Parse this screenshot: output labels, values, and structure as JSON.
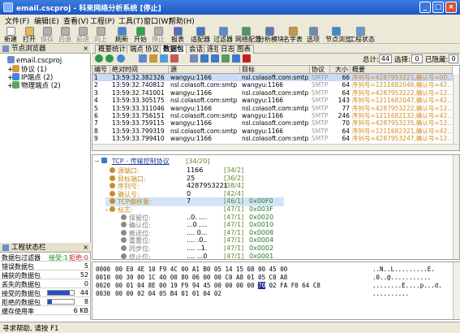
{
  "window": {
    "title": "email.cscproj - 科来网络分析系统 [停止]",
    "minimize": "_",
    "maximize": "□",
    "close": "×"
  },
  "menu": [
    "文件(F)",
    "编辑(E)",
    "查看(V)",
    "工程(P)",
    "工具(T)",
    "窗口(W)",
    "帮助(H)"
  ],
  "toolbar": [
    {
      "label": "新建",
      "icon": "new-icon",
      "color": "#f4f4f4",
      "enabled": true
    },
    {
      "label": "打开",
      "icon": "open-icon",
      "color": "#e8b84a",
      "enabled": true
    },
    {
      "label": "保存",
      "icon": "save-icon",
      "color": "#b0b0b0",
      "enabled": false
    },
    {
      "label": "后退",
      "icon": "back-icon",
      "color": "#b0b0b0",
      "enabled": false
    },
    {
      "label": "前进",
      "icon": "forward-icon",
      "color": "#b0b0b0",
      "enabled": false
    },
    {
      "label": "向上",
      "icon": "up-icon",
      "color": "#b0b0b0",
      "enabled": false
    },
    {
      "label": "刷新",
      "icon": "refresh-icon",
      "color": "#3a8ad8",
      "enabled": true
    },
    {
      "label": "开始",
      "icon": "start-icon",
      "color": "#2aa84a",
      "enabled": true
    },
    {
      "label": "停止",
      "icon": "stop-icon",
      "color": "#b0b0b0",
      "enabled": false
    },
    {
      "label": "报表",
      "icon": "report-icon",
      "color": "#4a70c0",
      "enabled": true
    },
    {
      "label": "适配器",
      "icon": "adapter-icon",
      "color": "#3a78c8",
      "enabled": true
    },
    {
      "label": "过滤器",
      "icon": "filter-icon",
      "color": "#5a8ad0",
      "enabled": true
    },
    {
      "label": "网络配置",
      "icon": "network-config-icon",
      "color": "#4a9a5a",
      "enabled": true
    },
    {
      "label": "分析模块",
      "icon": "analysis-module-icon",
      "color": "#5a7ab8",
      "enabled": true
    },
    {
      "label": "名字表",
      "icon": "name-table-icon",
      "color": "#c89a3a",
      "enabled": true
    },
    {
      "label": "选项",
      "icon": "options-icon",
      "color": "#6a8ab8",
      "enabled": true
    },
    {
      "label": "节点浏览",
      "icon": "node-browse-icon",
      "color": "#3a8ad8",
      "enabled": true
    },
    {
      "label": "工程状态",
      "icon": "project-status-icon",
      "color": "#5a9ad8",
      "enabled": true
    }
  ],
  "left_panel": {
    "title": "节点浏览器",
    "close": "×",
    "tree": [
      {
        "label": "email.cscproj",
        "indent": 0,
        "expander": "",
        "color": "#6a8ac8"
      },
      {
        "label": "协议 (1)",
        "indent": 1,
        "expander": "+",
        "color": "#d89a3a"
      },
      {
        "label": "IP端点 (2)",
        "indent": 1,
        "expander": "+",
        "color": "#3a8ad8"
      },
      {
        "label": "物理端点 (2)",
        "indent": 1,
        "expander": "+",
        "color": "#5aa85a"
      }
    ]
  },
  "status_panel": {
    "title": "工程状态栏",
    "close": "×",
    "header": {
      "label": "数据包过滤器",
      "accept": "接受:1",
      "reject": "拒绝:0"
    },
    "rows": [
      {
        "label": "错误数据包",
        "value": "5",
        "bar": null
      },
      {
        "label": "捕获的数据包",
        "value": "52",
        "bar": null
      },
      {
        "label": "丢失的数据包",
        "value": "0",
        "bar": null
      },
      {
        "label": "接受的数据包",
        "value": "44",
        "bar": 0.85
      },
      {
        "label": "拒绝的数据包",
        "value": "8",
        "bar": 0.15
      },
      {
        "label": "缓存使用率",
        "value": "6 KB",
        "bar": null
      }
    ]
  },
  "view_tabs": [
    "概要统计",
    "端点",
    "协议",
    "数据包",
    "会话",
    "连接",
    "日志",
    "图表"
  ],
  "active_tab": "数据包",
  "counters": {
    "total_label": "总计:",
    "total": "44",
    "selected_label": "选择:",
    "selected": "0",
    "hidden_label": "已隐藏:",
    "hidden": "0"
  },
  "table": {
    "columns": [
      "编号",
      "绝对时间",
      "源",
      "目标",
      "协议",
      "大小",
      "概要"
    ],
    "rows": [
      {
        "no": "1",
        "time": "13:59:32.382326",
        "src": "wangyu:1166",
        "dst": "nsl.colasoft.com:smtp",
        "proto": "SMTP",
        "size": "66",
        "summary": "序列号=4287953221,确认号=00...",
        "selected": true
      },
      {
        "no": "2",
        "time": "13:59:32.740812",
        "src": "nsl.colasoft.com:smtp",
        "dst": "wangyu:1166",
        "proto": "SMTP",
        "size": "64",
        "summary": "序列号=1211682046,确认号=42...",
        "selected": false
      },
      {
        "no": "3",
        "time": "13:59:32.741001",
        "src": "wangyu:1166",
        "dst": "nsl.colasoft.com:smtp",
        "proto": "SMTP",
        "size": "64",
        "summary": "序列号=4287953222,确认号=12...",
        "selected": false
      },
      {
        "no": "4",
        "time": "13:59:33.305175",
        "src": "nsl.colasoft.com:smtp",
        "dst": "wangyu:1166",
        "proto": "SMTP",
        "size": "143",
        "summary": "序列号=1211682047,确认号=42...",
        "selected": false
      },
      {
        "no": "5",
        "time": "13:59:33.311046",
        "src": "wangyu:1166",
        "dst": "nsl.colasoft.com:smtp",
        "proto": "SMTP",
        "size": "77",
        "summary": "序列号=4287953222,确认号=12...",
        "selected": false
      },
      {
        "no": "6",
        "time": "13:59:33.756151",
        "src": "nsl.colasoft.com:smtp",
        "dst": "wangyu:1166",
        "proto": "SMTP",
        "size": "246",
        "summary": "序列号=1211682132,确认号=42...",
        "selected": false
      },
      {
        "no": "7",
        "time": "13:59:33.759115",
        "src": "wangyu:1166",
        "dst": "nsl.colasoft.com:smtp",
        "proto": "SMTP",
        "size": "70",
        "summary": "序列号=4287953235,确认号=12...",
        "selected": false
      },
      {
        "no": "8",
        "time": "13:59:33.799319",
        "src": "nsl.colasoft.com:smtp",
        "dst": "wangyu:1166",
        "proto": "SMTP",
        "size": "64",
        "summary": "序列号=1211682321,确认号=42...",
        "selected": false
      },
      {
        "no": "9",
        "time": "13:59:33.799410",
        "src": "wangyu:1166",
        "dst": "nsl.colasoft.com:smtp",
        "proto": "SMTP",
        "size": "64",
        "summary": "序列号=4287953247,确认号=12...",
        "selected": false
      }
    ]
  },
  "decode": {
    "root": {
      "label": "TCP - 传输控制协议",
      "range": "[34/20]"
    },
    "fields": [
      {
        "label": "源端口:",
        "value": "1166",
        "range": "[34/2]",
        "hex": "",
        "level": 1,
        "expander": "",
        "highlight": false
      },
      {
        "label": "目标端口:",
        "value": "25",
        "range": "[36/2]",
        "hex": "",
        "level": 1,
        "expander": "",
        "highlight": false
      },
      {
        "label": "序列号:",
        "value": "4287953221",
        "range": "[38/4]",
        "hex": "",
        "level": 1,
        "expander": "",
        "highlight": false
      },
      {
        "label": "确认号:",
        "value": "0",
        "range": "[42/4]",
        "hex": "",
        "level": 1,
        "expander": "",
        "highlight": false
      },
      {
        "label": "TCP偏移量:",
        "value": "7",
        "range": "[46/1]",
        "hex": "0x00F0",
        "level": 1,
        "expander": "",
        "highlight": true
      },
      {
        "label": "标志:",
        "value": "",
        "range": "[47/1]",
        "hex": "0x003F",
        "level": 1,
        "expander": "-",
        "highlight": false
      },
      {
        "label": "保留位:",
        "value": "..0. ....",
        "range": "[47/1]",
        "hex": "0x0020",
        "level": 2,
        "expander": "",
        "highlight": false
      },
      {
        "label": "确认位:",
        "value": "...0 ....",
        "range": "[47/1]",
        "hex": "0x0010",
        "level": 2,
        "expander": "",
        "highlight": false
      },
      {
        "label": "推送位:",
        "value": ".... 0...",
        "range": "[47/1]",
        "hex": "0x0008",
        "level": 2,
        "expander": "",
        "highlight": false
      },
      {
        "label": "重置位:",
        "value": ".... .0..",
        "range": "[47/1]",
        "hex": "0x0004",
        "level": 2,
        "expander": "",
        "highlight": false
      },
      {
        "label": "同步位:",
        "value": ".... ..1.",
        "range": "[47/1]",
        "hex": "0x0002",
        "level": 2,
        "expander": "",
        "highlight": false
      },
      {
        "label": "终止位:",
        "value": ".... ...0",
        "range": "[47/1]",
        "hex": "0x0001",
        "level": 2,
        "expander": "",
        "highlight": false
      }
    ]
  },
  "hex": {
    "offsets": [
      "0000",
      "0010",
      "0020",
      "0030"
    ],
    "lines": [
      {
        "pre": "00 E0 4E 10 F9 4C 00 A1 B0 05 14 15 08 00 45 00",
        "hl": "",
        "post": "",
        "ascii": "..N..L.........E."
      },
      {
        "pre": "00 30 00 1C 40 00 80 06 00 00 C0 A8 01 05 C0 A8",
        "hl": "",
        "post": "",
        "ascii": ".0..@..........."
      },
      {
        "pre": "00 01 04 8E 00 19 F9 94 45 00 00 00 00 ",
        "hl": "70",
        "post": " 02 FA F0 64 C8",
        "ascii": "........E....p...d."
      },
      {
        "pre": "00 00 02 04 05 B4 01 01 04 02",
        "hl": "",
        "post": "",
        "ascii": ".........."
      }
    ]
  },
  "status_bar": "寻求帮助, 请按 F1"
}
